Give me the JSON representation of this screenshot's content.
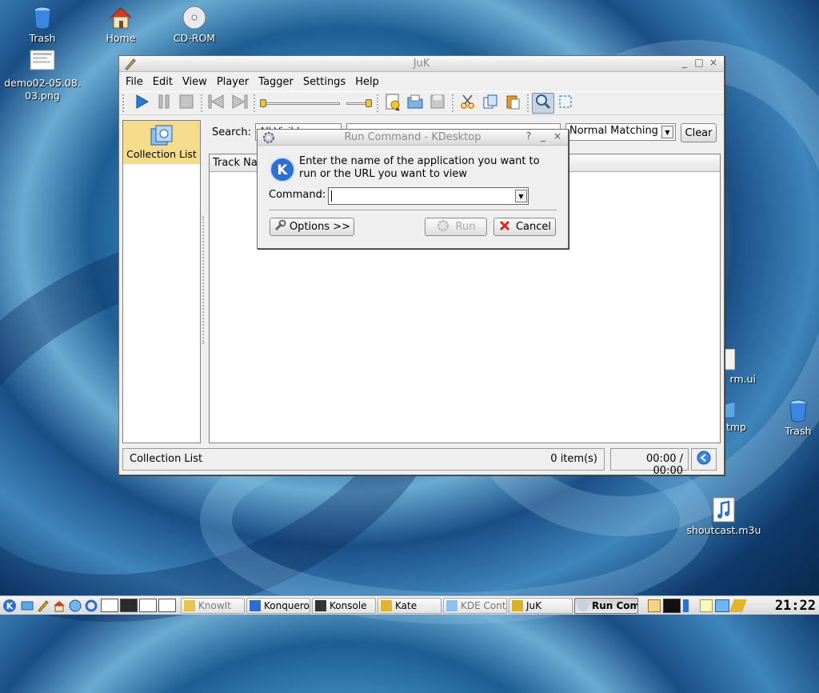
{
  "desktop": {
    "icons": [
      {
        "label": "Trash",
        "icon": "trash-icon"
      },
      {
        "label": "Home",
        "icon": "home-icon"
      },
      {
        "label": "CD-ROM",
        "icon": "cdrom-icon"
      },
      {
        "label": "demo02-05.08.\n03.png",
        "icon": "image-file-icon"
      },
      {
        "label": "rm.ui",
        "icon": "file-icon"
      },
      {
        "label": "tmp",
        "icon": "folder-icon"
      },
      {
        "label": "Trash",
        "icon": "trash-icon"
      },
      {
        "label": "shoutcast.m3u",
        "icon": "audio-playlist-icon"
      }
    ]
  },
  "juk": {
    "title": "JuK",
    "menu": [
      "File",
      "Edit",
      "View",
      "Player",
      "Tagger",
      "Settings",
      "Help"
    ],
    "sidebar": {
      "item": "Collection List"
    },
    "search": {
      "label": "Search:",
      "combo_value": "All Visible",
      "mode": "Normal Matching",
      "clear_label": "Clear"
    },
    "table": {
      "first_column": "Track Name"
    },
    "status": {
      "playlist": "Collection List",
      "count": "0 item(s)",
      "time": "00:00 / 00:00"
    }
  },
  "run_dialog": {
    "title": "Run Command - KDesktop",
    "description": "Enter the name of the application you want to run or the URL you want to view",
    "command_label": "Command:",
    "command_value": "",
    "options_label": "Options >>",
    "run_label": "Run",
    "cancel_label": "Cancel"
  },
  "taskbar": {
    "tasks": [
      "KnowIt",
      "Konqueror",
      "Konsole",
      "Kate",
      "KDE Control",
      "JuK",
      "Run Command"
    ],
    "active_task": "Run Command",
    "clock": "21:22"
  },
  "colors": {
    "desktop_blue": "#1d5e93",
    "selection_yellow": "#f5dc8c",
    "play_blue": "#2b7bd3",
    "cancel_red": "#d82a1c"
  }
}
